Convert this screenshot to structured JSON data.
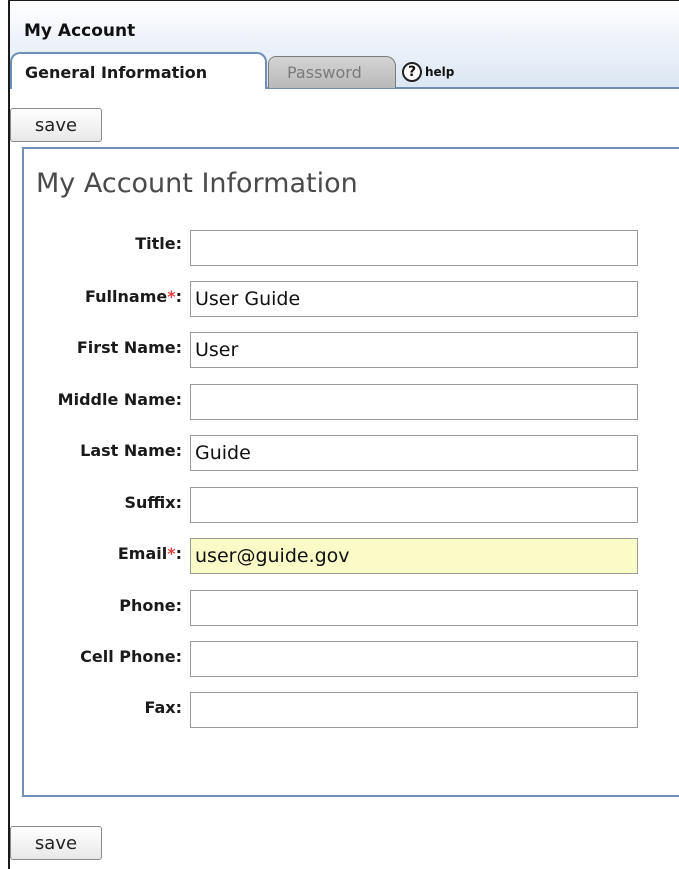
{
  "header": {
    "title": "My Account",
    "tabs": [
      {
        "label": "General Information",
        "active": true
      },
      {
        "label": "Password",
        "active": false
      }
    ],
    "help_label": "help",
    "help_icon": "question-icon"
  },
  "toolbar": {
    "save_label": "save"
  },
  "form": {
    "title": "My Account Information",
    "required_marker": "*",
    "fields": [
      {
        "label": "Title:",
        "value": ""
      },
      {
        "label": "Fullname",
        "label_suffix": ":",
        "required": true,
        "value": "User Guide"
      },
      {
        "label": "First Name:",
        "value": "User"
      },
      {
        "label": "Middle Name:",
        "value": ""
      },
      {
        "label": "Last Name:",
        "value": "Guide"
      },
      {
        "label": "Suffix:",
        "value": ""
      },
      {
        "label": "Email",
        "label_suffix": ":",
        "required": true,
        "value": "user@guide.gov",
        "highlighted": true
      },
      {
        "label": "Phone:",
        "value": ""
      },
      {
        "label": "Cell Phone:",
        "value": ""
      },
      {
        "label": "Fax:",
        "value": ""
      }
    ]
  },
  "colors": {
    "tab_border": "#6f8fb6",
    "required_star": "#e0443c",
    "autofill_highlight": "#fafbc6"
  }
}
